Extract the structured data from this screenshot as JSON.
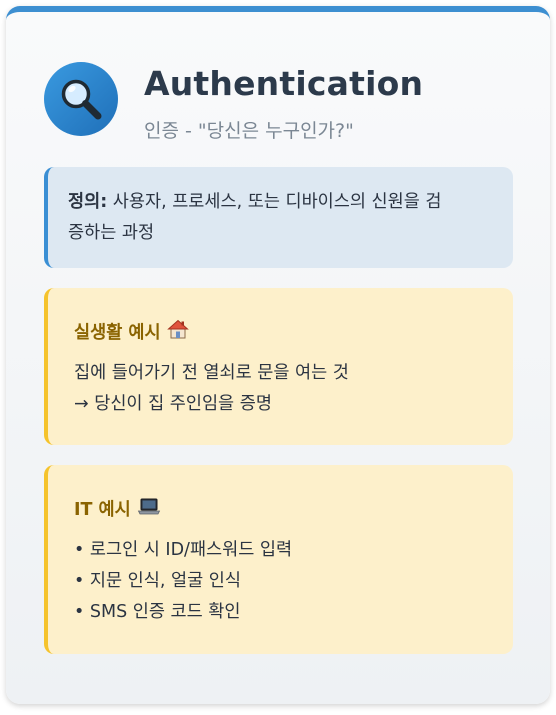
{
  "header": {
    "icon": "magnifier-icon",
    "title": "Authentication",
    "subtitle": "인증 - \"당신은 누구인가?\""
  },
  "definition": {
    "label": "정의:",
    "text_line1": " 사용자, 프로세스, 또는 디바이스의 신원을 검",
    "text_line2": "증하는 과정"
  },
  "examples": [
    {
      "title": "실생활 예시",
      "icon": "house-icon",
      "lines": [
        "집에 들어가기 전 열쇠로 문을 여는 것",
        "→ 당신이 집 주인임을 증명"
      ]
    },
    {
      "title": "IT 예시",
      "icon": "laptop-icon",
      "lines": [
        "• 로그인 시 ID/패스워드 입력",
        "• 지문 인식, 얼굴 인식",
        "• SMS 인증 코드 확인"
      ]
    }
  ],
  "colors": {
    "accent_blue": "#3d8fd1",
    "title_text": "#2c3a4b",
    "subtitle_text": "#7b8794",
    "definition_bg": "#dde8f2",
    "example_bg": "#fdf0cb",
    "example_border": "#f5c32c",
    "example_title": "#8a6300"
  }
}
